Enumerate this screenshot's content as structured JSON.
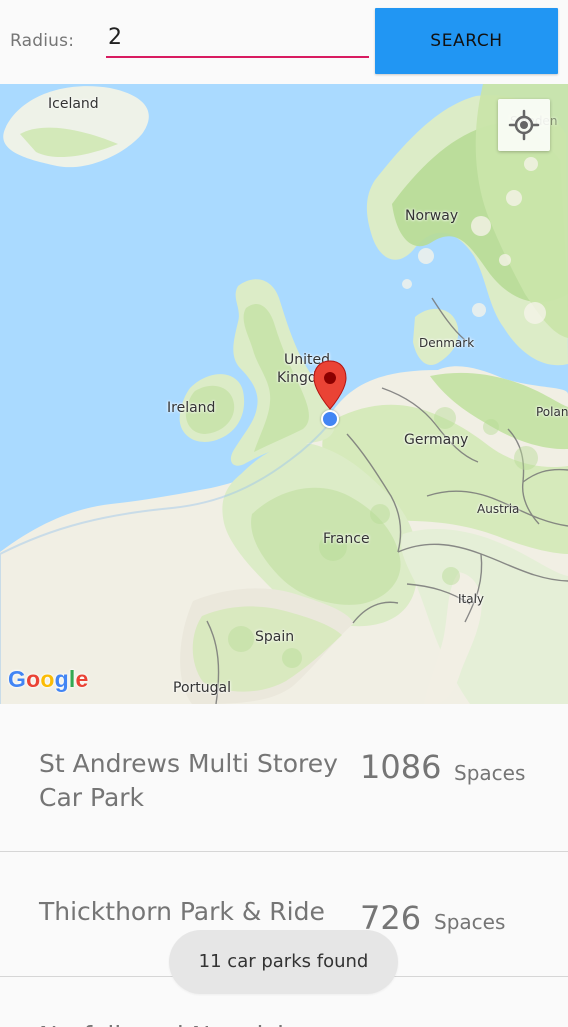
{
  "search": {
    "radius_label": "Radius:",
    "radius_value": "2",
    "button_label": "SEARCH"
  },
  "map": {
    "labels": {
      "iceland": "Iceland",
      "norway": "Norway",
      "denmark": "Denmark",
      "united_kingdom_line_1": "United",
      "united_kingdom_line_2": "Kingdom",
      "ireland": "Ireland",
      "germany": "Germany",
      "poland": "Poland",
      "austria": "Austria",
      "france": "France",
      "italy": "Italy",
      "spain": "Spain",
      "portugal": "Portugal",
      "sweden": "Sweden"
    },
    "logo_letters": [
      "G",
      "o",
      "o",
      "g",
      "l",
      "e"
    ],
    "locate_icon": "my-location-icon",
    "marker_icon": "map-pin-icon",
    "colors": {
      "water": "#aadaff",
      "land": "#f2efe4",
      "forest": "#c7e3a8",
      "land_dark": "#d7ebbb",
      "border": "#777777",
      "marker": "#ea4335",
      "blue_dot": "#4285f4",
      "accent": "#2196f3",
      "input_underline": "#d81b60"
    }
  },
  "results": {
    "spaces_label": "Spaces",
    "items": [
      {
        "name": "St Andrews Multi Storey Car Park",
        "spaces": "1086"
      },
      {
        "name": "Thickthorn Park & Ride",
        "spaces": "726"
      },
      {
        "name": "Norfolk and Norwich",
        "spaces": ""
      }
    ]
  },
  "toast": {
    "message": "11 car parks found"
  }
}
